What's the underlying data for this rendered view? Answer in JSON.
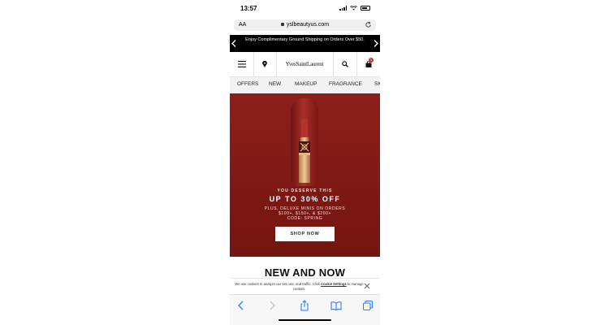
{
  "status": {
    "time": "13:57"
  },
  "browser": {
    "text_size": "AA",
    "url": "yslbeautyus.com"
  },
  "promo_banner": {
    "text": "Enjoy Complimentary Ground Shipping on Orders Over $50."
  },
  "header": {
    "logo": "YvesSaintLaurent",
    "cart_count": "1"
  },
  "nav": {
    "items": [
      "OFFERS",
      "NEW",
      "MAKEUP",
      "FRAGRANCE",
      "SK"
    ]
  },
  "hero": {
    "kicker": "YOU DESERVE THIS",
    "title": "UP TO 30% OFF",
    "body_line1": "PLUS, DELUXE MINIS ON ORDERS",
    "body_line2": "$100+, $150+, & $200+",
    "body_line3": "CODE: SPRING",
    "button": "SHOP NOW"
  },
  "section": {
    "title": "NEW AND NOW"
  },
  "cookie": {
    "text_before": "We use cookies to analyze our site use, and traffic. Click ",
    "link": "Cookie Settings",
    "text_after": " to manage cookies."
  },
  "colors": {
    "hero_red": "#8e1f1a",
    "promo_black": "#000000",
    "cart_badge": "#c0392b"
  }
}
